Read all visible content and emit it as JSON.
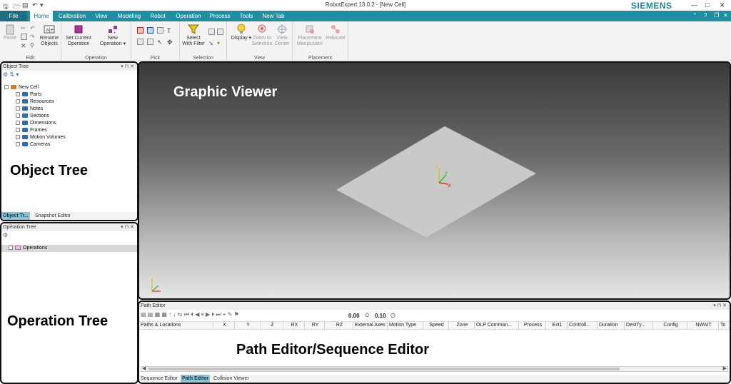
{
  "titlebar": {
    "title": "RobotExpert 13.0.2 - [New Cell]",
    "brand": "SIEMENS",
    "window_controls": [
      "—",
      "□",
      "✕"
    ]
  },
  "tabs": [
    "File",
    "Home",
    "Calibration",
    "View",
    "Modeling",
    "Robot",
    "Operation",
    "Process",
    "Tools",
    "New Tab"
  ],
  "active_tab": "Home",
  "ribbon": {
    "edit": {
      "label": "Edit",
      "paste": "Paste",
      "rename_line1": "Rename",
      "rename_line2": "Objects"
    },
    "operation": {
      "label": "Operation",
      "set_current_line1": "Set Current",
      "set_current_line2": "Operation",
      "new_op_line1": "New",
      "new_op_line2": "Operation"
    },
    "pick": {
      "label": "Pick"
    },
    "selection": {
      "label": "Selection",
      "select_line1": "Select",
      "select_line2": "With Filter"
    },
    "view": {
      "label": "View",
      "display": "Display",
      "zoom_line1": "Zoom to",
      "zoom_line2": "Selection",
      "center_line1": "View",
      "center_line2": "Center"
    },
    "placement": {
      "label": "Placement",
      "manip_line1": "Placement",
      "manip_line2": "Manipulator",
      "relocate": "Relocate"
    }
  },
  "object_tree": {
    "title": "Object Tree",
    "root": "New Cell",
    "items": [
      "Parts",
      "Resources",
      "Notes",
      "Sections",
      "Dimensions",
      "Frames",
      "Motion Volumes",
      "Cameras"
    ],
    "big_label": "Object Tree",
    "bottom_tabs": [
      "Object Tr...",
      "Snapshot Editor"
    ]
  },
  "operation_tree": {
    "title": "Operation Tree",
    "root": "Operations",
    "big_label": "Operation Tree"
  },
  "viewer": {
    "big_label": "Graphic Viewer",
    "axis_x": "x",
    "axis_y": "y",
    "axis_z": "z"
  },
  "path_editor": {
    "title": "Path Editor",
    "speed_value": "0.00",
    "time_value": "0.10",
    "columns": [
      "Paths & Locations",
      "X",
      "Y",
      "Z",
      "RX",
      "RY",
      "RZ",
      "External Axes",
      "Motion Type",
      "Speed",
      "Zone",
      "OLP Comman...",
      "Process",
      "Ext1",
      "Controll...",
      "Duration",
      "DestTy...",
      "Config",
      "NWAIT",
      "To"
    ],
    "big_label": "Path Editor/Sequence Editor",
    "bottom_tabs": [
      "Sequence Editor",
      "Path Editor",
      "Collision Viewer"
    ]
  },
  "colors": {
    "ribbon_accent": "#1e8ea0",
    "brand": "#1a8a9a",
    "active_bottom_tab": "#8fc2d6"
  }
}
